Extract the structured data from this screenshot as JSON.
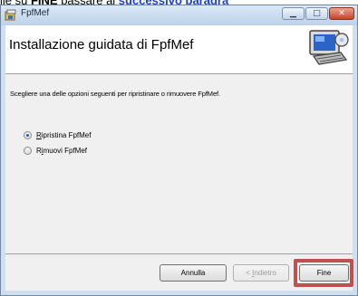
{
  "background_doc": {
    "text_a": "ile su ",
    "text_bold": "FINE",
    "text_b": " passare al ",
    "text_link": "successivo paragra"
  },
  "window": {
    "title": "FpfMef",
    "header_title": "Installazione guidata di FpfMef",
    "instruction": "Scegliere una delle opzioni seguenti per ripristinare o rimuovere FpfMef.",
    "options": [
      {
        "mnemonic": "R",
        "rest": "ipristina FpfMef",
        "checked": true
      },
      {
        "pre": "R",
        "mnemonic": "i",
        "rest": "muovi FpfMef",
        "checked": false
      }
    ]
  },
  "buttons": {
    "cancel": "Annulla",
    "back_prefix": "< ",
    "back_mnemonic": "I",
    "back_rest": "ndietro",
    "finish": "Fine"
  },
  "colors": {
    "highlight": "#c0504d",
    "radio_dot": "#1d5cb8",
    "link": "#1a3fd0"
  }
}
